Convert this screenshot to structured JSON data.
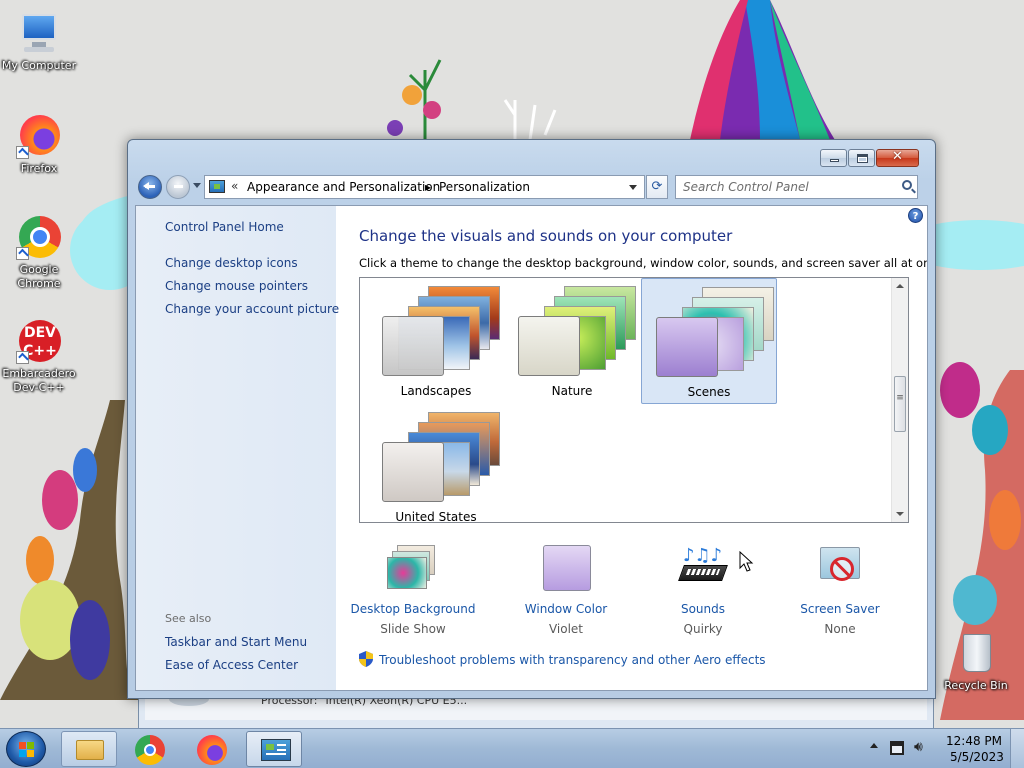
{
  "desktop": {
    "icons": [
      {
        "label": "My Computer"
      },
      {
        "label": "Firefox"
      },
      {
        "label": "Google Chrome"
      },
      {
        "label": "Embarcadero Dev-C++"
      },
      {
        "label": "Recycle Bin"
      }
    ],
    "background_window": {
      "processor_label": "Processor:",
      "processor_value": "Intel(R) Xeon(R) CPU E5..."
    }
  },
  "window": {
    "title_buttons": {
      "minimize": "—",
      "maximize": "□",
      "close": "✕"
    },
    "address": {
      "chevron": "«",
      "crumbs": [
        "Appearance and Personalization",
        "Personalization"
      ],
      "separator": "▸"
    },
    "refresh_icon": "⟳",
    "search": {
      "placeholder": "Search Control Panel"
    },
    "left_pane": {
      "links": [
        "Control Panel Home",
        "Change desktop icons",
        "Change mouse pointers",
        "Change your account picture"
      ],
      "see_also_label": "See also",
      "see_also_links": [
        "Taskbar and Start Menu",
        "Ease of Access Center"
      ]
    },
    "main": {
      "help_icon": "?",
      "title": "Change the visuals and sounds on your computer",
      "description": "Click a theme to change the desktop background, window color, sounds, and screen saver all at once.",
      "themes": [
        {
          "name": "Landscapes",
          "selected": false
        },
        {
          "name": "Nature",
          "selected": false
        },
        {
          "name": "Scenes",
          "selected": true
        },
        {
          "name": "United States",
          "selected": false
        }
      ],
      "settings": [
        {
          "label": "Desktop Background",
          "value": "Slide Show"
        },
        {
          "label": "Window Color",
          "value": "Violet"
        },
        {
          "label": "Sounds",
          "value": "Quirky"
        },
        {
          "label": "Screen Saver",
          "value": "None"
        }
      ],
      "troubleshoot_link": "Troubleshoot problems with transparency and other Aero effects"
    }
  },
  "taskbar": {
    "pinned": [
      "windows-explorer",
      "google-chrome",
      "firefox",
      "control-panel"
    ],
    "clock": {
      "time": "12:48 PM",
      "date": "5/5/2023"
    }
  },
  "colors": {
    "link": "#1b57a8",
    "title": "#1e3287",
    "selected_theme": "#d9e6f6",
    "window_color_swatch": "#c9b6e4"
  }
}
